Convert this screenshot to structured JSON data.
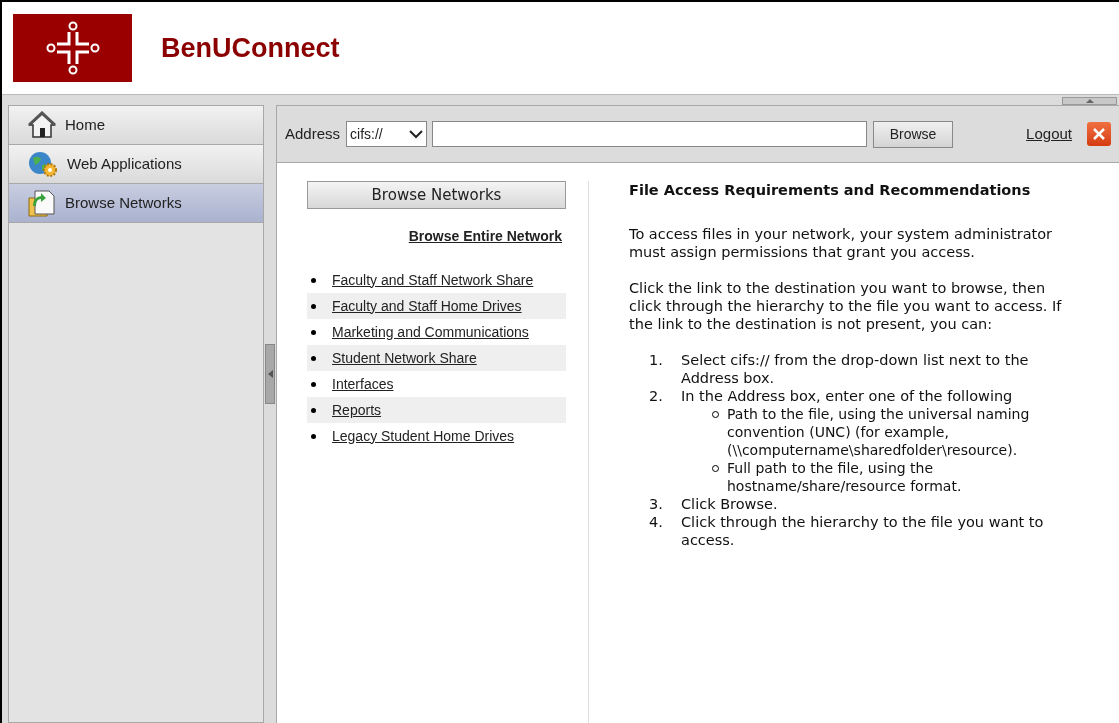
{
  "header": {
    "title": "BenUConnect"
  },
  "sidebar": {
    "items": [
      {
        "label": "Home",
        "kind": "home",
        "selected": false
      },
      {
        "label": "Web Applications",
        "kind": "web",
        "selected": false
      },
      {
        "label": "Browse Networks",
        "kind": "network",
        "selected": true
      }
    ]
  },
  "toolbar": {
    "address_label": "Address",
    "protocol": "cifs://",
    "browse_button": "Browse",
    "logout": "Logout"
  },
  "browse_panel": {
    "heading": "Browse Networks",
    "entire_network_link": "Browse Entire Network",
    "links": [
      "Faculty and Staff Network Share",
      "Faculty and Staff Home Drives",
      "Marketing and Communications",
      "Student Network Share",
      "Interfaces",
      "Reports",
      "Legacy Student Home Drives"
    ]
  },
  "info": {
    "title": "File Access Requirements and Recommendations",
    "paragraphs": [
      "To access files in your network, your system administrator must assign permissions that grant you access.",
      "Click the link to the destination you want to browse, then click through the hierarchy to the file you want to access. If the link to the destination is not present, you can:"
    ],
    "steps": [
      {
        "number": "1.",
        "text": "Select cifs:// from the drop-down list next to the Address box."
      },
      {
        "number": "2.",
        "text": "In the Address box, enter one of the following",
        "children": [
          "Path to the file, using the universal naming convention (UNC) (for example, (\\\\computername\\sharedfolder\\resource).",
          "Full path to the file, using the hostname/share/resource format."
        ]
      },
      {
        "number": "3.",
        "text": "Click Browse."
      },
      {
        "number": "4.",
        "text": "Click through the hierarchy to the file you want to access."
      }
    ]
  }
}
